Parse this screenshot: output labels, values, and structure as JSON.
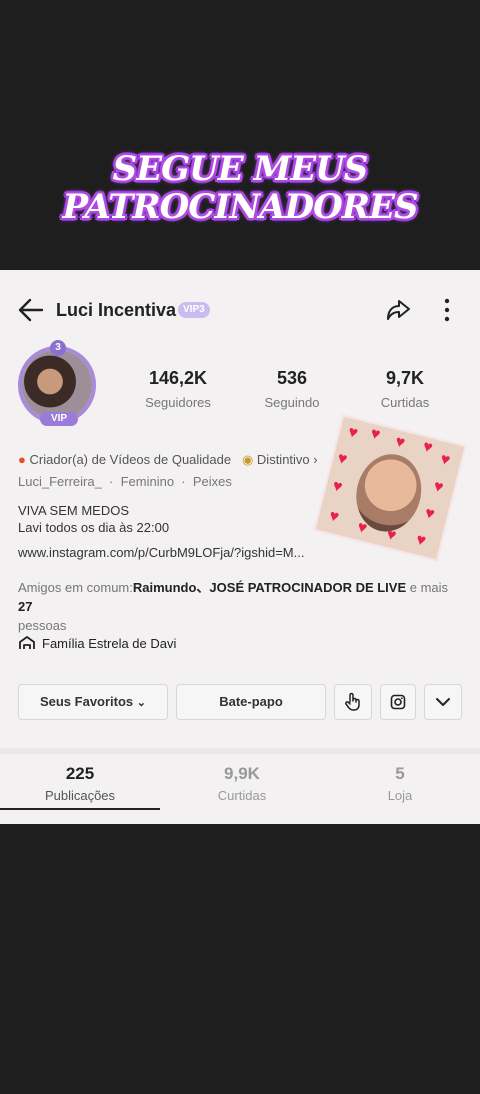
{
  "banner": {
    "line1": "SEGUE MEUS",
    "line2": "PATROCINADORES"
  },
  "header": {
    "title": "Luci Incentiva",
    "vip_tag": "VIP3"
  },
  "avatar": {
    "level": "3",
    "ribbon": "VIP"
  },
  "stats": [
    {
      "value": "146,2K",
      "label": "Seguidores"
    },
    {
      "value": "536",
      "label": "Seguindo"
    },
    {
      "value": "9,7K",
      "label": "Curtidas"
    }
  ],
  "profile": {
    "creator": "Criador(a) de Vídeos de Qualidade",
    "distinctive": "Distintivo",
    "username": "Luci_Ferreira_",
    "gender": "Feminino",
    "sign": "Peixes",
    "bio_line1": "VIVA SEM MEDOS",
    "bio_line2": "Lavi todos os dia às 22:00",
    "link": "www.instagram.com/p/CurbM9LOFja/?igshid=M...",
    "friends_prefix": "Amigos em comum:",
    "friends_names": "Raimundo、JOSÉ PATROCINADOR DE LIVE",
    "friends_middle": " e mais ",
    "friends_count": "27",
    "friends_suffix": "pessoas",
    "family": "Família Estrela de Davi"
  },
  "buttons": {
    "favorites": "Seus Favoritos",
    "chat": "Bate-papo"
  },
  "tabs": [
    {
      "value": "225",
      "label": "Publicações"
    },
    {
      "value": "9,9K",
      "label": "Curtidas"
    },
    {
      "value": "5",
      "label": "Loja"
    }
  ],
  "colors": {
    "accent": "#8a2be2",
    "vip": "#9a7bd9",
    "creator_dot": "#e8502a",
    "sticker_hearts": "#e8204a"
  }
}
